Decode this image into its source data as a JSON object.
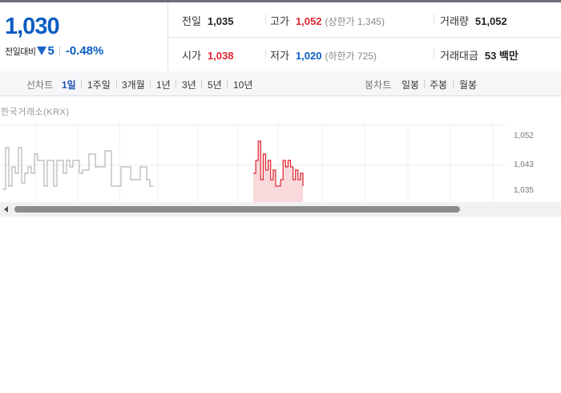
{
  "quote": {
    "price": "1,030",
    "change_label": "전일대비",
    "change_value": "5",
    "change_pct": "-0.48%",
    "prev_close": {
      "label": "전일",
      "value": "1,035"
    },
    "high": {
      "label": "고가",
      "value": "1,052",
      "limit": "(상한가 1,345)"
    },
    "volume": {
      "label": "거래량",
      "value": "51,052"
    },
    "open": {
      "label": "시가",
      "value": "1,038"
    },
    "low": {
      "label": "저가",
      "value": "1,020",
      "limit": "(하한가 725)"
    },
    "trade_value": {
      "label": "거래대금",
      "value": "53 백만"
    }
  },
  "period_bar": {
    "line_label": "선차트",
    "line_periods": [
      "1일",
      "1주일",
      "3개월",
      "1년",
      "3년",
      "5년",
      "10년"
    ],
    "active_period": "1일",
    "candle_label": "봉차트",
    "candle_periods": [
      "일봉",
      "주봉",
      "월봉"
    ]
  },
  "exchange_label": "한국거래소(KRX)",
  "colors": {
    "price_blue": "#0a5dc2",
    "up_red": "#e0252f",
    "line_gray": "#b3b3b3",
    "fill_red": "#f7c9cd"
  },
  "chart_data": {
    "type": "line",
    "y_ticks": [
      "1,052",
      "1,043",
      "1,035"
    ],
    "ylim": [
      1030,
      1055
    ],
    "grid": true,
    "legend": "none",
    "series": [
      {
        "values": [
          1035,
          1048,
          1036,
          1042,
          1040,
          1048,
          1037,
          1040,
          1042,
          1040,
          1046,
          1044,
          1044,
          1036,
          1044,
          1044,
          1036,
          1044,
          1044,
          1040,
          1044,
          1042,
          1044,
          1044,
          1040,
          1041,
          1041,
          1046,
          1046,
          1042,
          1042,
          1042,
          1047,
          1047,
          1036,
          1036,
          1036,
          1042,
          1042,
          1042,
          1038,
          1038,
          1038,
          1042,
          1042,
          1038,
          1036,
          1036
        ]
      },
      {
        "values": [
          1040,
          1044,
          1050,
          1038,
          1046,
          1041,
          1044,
          1038,
          1041,
          1036,
          1036,
          1038,
          1044,
          1042,
          1044,
          1042,
          1038,
          1041,
          1038,
          1040,
          1036
        ]
      }
    ]
  }
}
